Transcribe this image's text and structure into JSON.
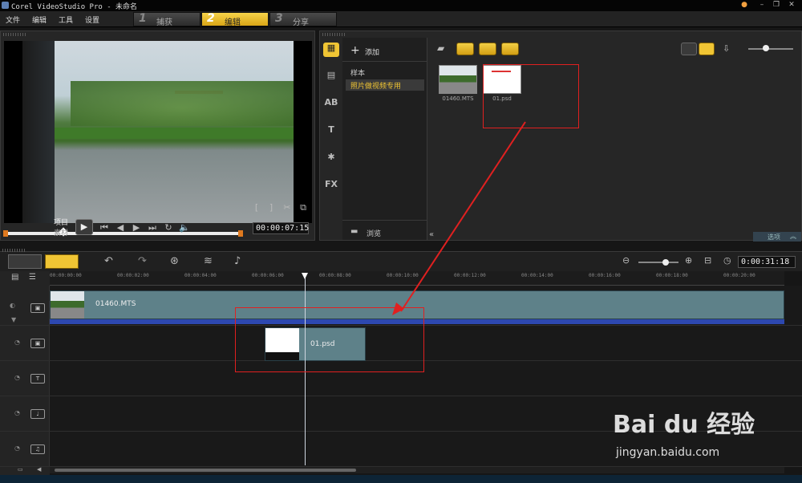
{
  "window": {
    "title": "Corel VideoStudio Pro - 未命名"
  },
  "menu": [
    "文件",
    "编辑",
    "工具",
    "设置"
  ],
  "steps": [
    {
      "num": "1",
      "label": "捕获",
      "active": false
    },
    {
      "num": "2",
      "label": "编辑",
      "active": true
    },
    {
      "num": "3",
      "label": "分享",
      "active": false
    }
  ],
  "preview": {
    "mode_project": "项目",
    "mode_clip": "素材",
    "timecode": "00:00:07:",
    "timecode_frames": "15",
    "scrub_position": 0.25
  },
  "library": {
    "add_label": "添加",
    "folders": [
      "样本",
      "照片做视频专用"
    ],
    "selected_folder": "照片做视频专用",
    "browse_label": "浏览",
    "options_label": "选项",
    "items": [
      {
        "name": "01460.MTS",
        "type": "video"
      },
      {
        "name": "01.psd",
        "type": "image"
      }
    ]
  },
  "timeline": {
    "timecode": "0:00:31:",
    "timecode_frames": "18",
    "ruler": [
      "00:00:00:00",
      "00:00:02:00",
      "00:00:04:00",
      "00:00:06:00",
      "00:00:08:00",
      "00:00:10:00",
      "00:00:12:00",
      "00:00:14:00",
      "00:00:16:00",
      "00:00:18:00",
      "00:00:20:00"
    ],
    "video_clip": "01460.MTS",
    "overlay_clip": "01.psd",
    "playhead_time": "00:00:07:15"
  },
  "watermark": {
    "brand": "Bai du 经验",
    "url": "jingyan.baidu.com"
  },
  "colors": {
    "accent": "#f0c534",
    "annotation": "#e02020",
    "clip": "#5e8189"
  }
}
